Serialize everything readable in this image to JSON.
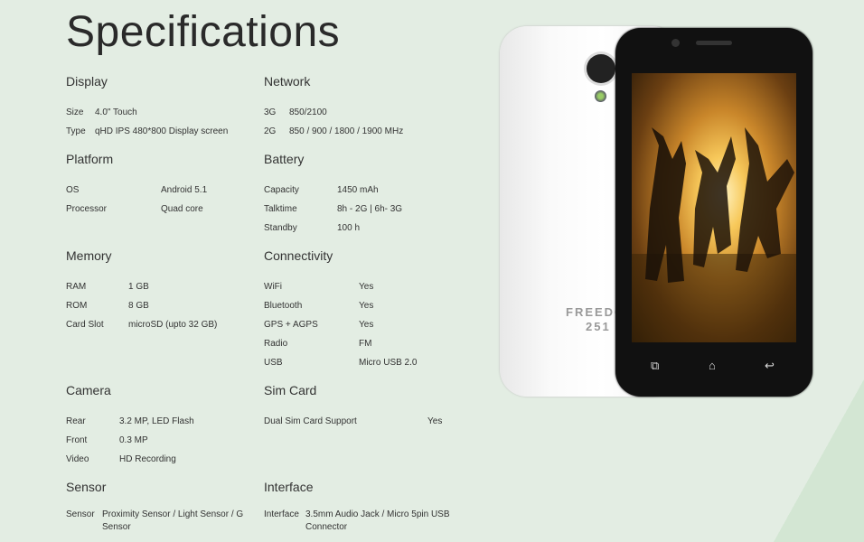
{
  "title": "Specifications",
  "brand": {
    "line1": "FREEDO",
    "line2": "251"
  },
  "sections": {
    "display": {
      "title": "Display",
      "rows": [
        {
          "k": "Size",
          "v": "4.0\" Touch"
        },
        {
          "k": "Type",
          "v": "qHD IPS 480*800 Display screen"
        }
      ]
    },
    "network": {
      "title": "Network",
      "rows": [
        {
          "k": "3G",
          "v": "850/2100"
        },
        {
          "k": "2G",
          "v": "850 / 900 / 1800 / 1900 MHz"
        }
      ]
    },
    "platform": {
      "title": "Platform",
      "rows": [
        {
          "k": "OS",
          "v": "Android 5.1"
        },
        {
          "k": "Processor",
          "v": "Quad core"
        }
      ]
    },
    "battery": {
      "title": "Battery",
      "rows": [
        {
          "k": "Capacity",
          "v": "1450 mAh"
        },
        {
          "k": "Talktime",
          "v": "8h - 2G | 6h- 3G"
        },
        {
          "k": "Standby",
          "v": "100 h"
        }
      ]
    },
    "memory": {
      "title": "Memory",
      "rows": [
        {
          "k": "RAM",
          "v": "1 GB"
        },
        {
          "k": "ROM",
          "v": "8 GB"
        },
        {
          "k": "Card Slot",
          "v": "microSD (upto 32 GB)"
        }
      ]
    },
    "connectivity": {
      "title": "Connectivity",
      "rows": [
        {
          "k": "WiFi",
          "v": "Yes"
        },
        {
          "k": "Bluetooth",
          "v": "Yes"
        },
        {
          "k": "GPS + AGPS",
          "v": "Yes"
        },
        {
          "k": "Radio",
          "v": "FM"
        },
        {
          "k": "USB",
          "v": "Micro USB 2.0"
        }
      ]
    },
    "camera": {
      "title": "Camera",
      "rows": [
        {
          "k": "Rear",
          "v": "3.2 MP, LED Flash"
        },
        {
          "k": "Front",
          "v": "0.3 MP"
        },
        {
          "k": "Video",
          "v": "HD Recording"
        }
      ]
    },
    "simcard": {
      "title": "Sim Card",
      "rows": [
        {
          "k": "Dual Sim Card Support",
          "v": "Yes"
        }
      ]
    },
    "sensor": {
      "title": "Sensor",
      "rows": [
        {
          "k": "Sensor",
          "v1": "Proximity Sensor / Light Sensor / G",
          "v2": "Sensor"
        }
      ]
    },
    "interface": {
      "title": "Interface",
      "rows": [
        {
          "k": "Interface",
          "v1": "3.5mm Audio Jack / Micro 5pin USB",
          "v2": "Connector"
        }
      ]
    }
  },
  "icons": [
    "recent-apps-icon",
    "home-icon",
    "back-icon"
  ]
}
